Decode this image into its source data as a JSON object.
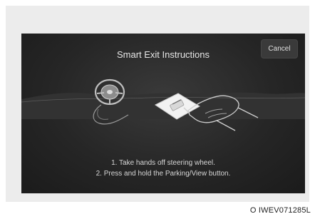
{
  "dialog": {
    "title": "Smart Exit Instructions",
    "cancel_label": "Cancel",
    "instructions": [
      "1. Take hands off steering wheel.",
      "2. Press and hold the Parking/View button."
    ]
  },
  "footnote": "O IWEV071285L",
  "icons": [
    "steering-wheel-icon",
    "hand-pressing-button-icon"
  ],
  "colors": {
    "screen_bg": "#262626",
    "text": "#e6e6e6"
  }
}
